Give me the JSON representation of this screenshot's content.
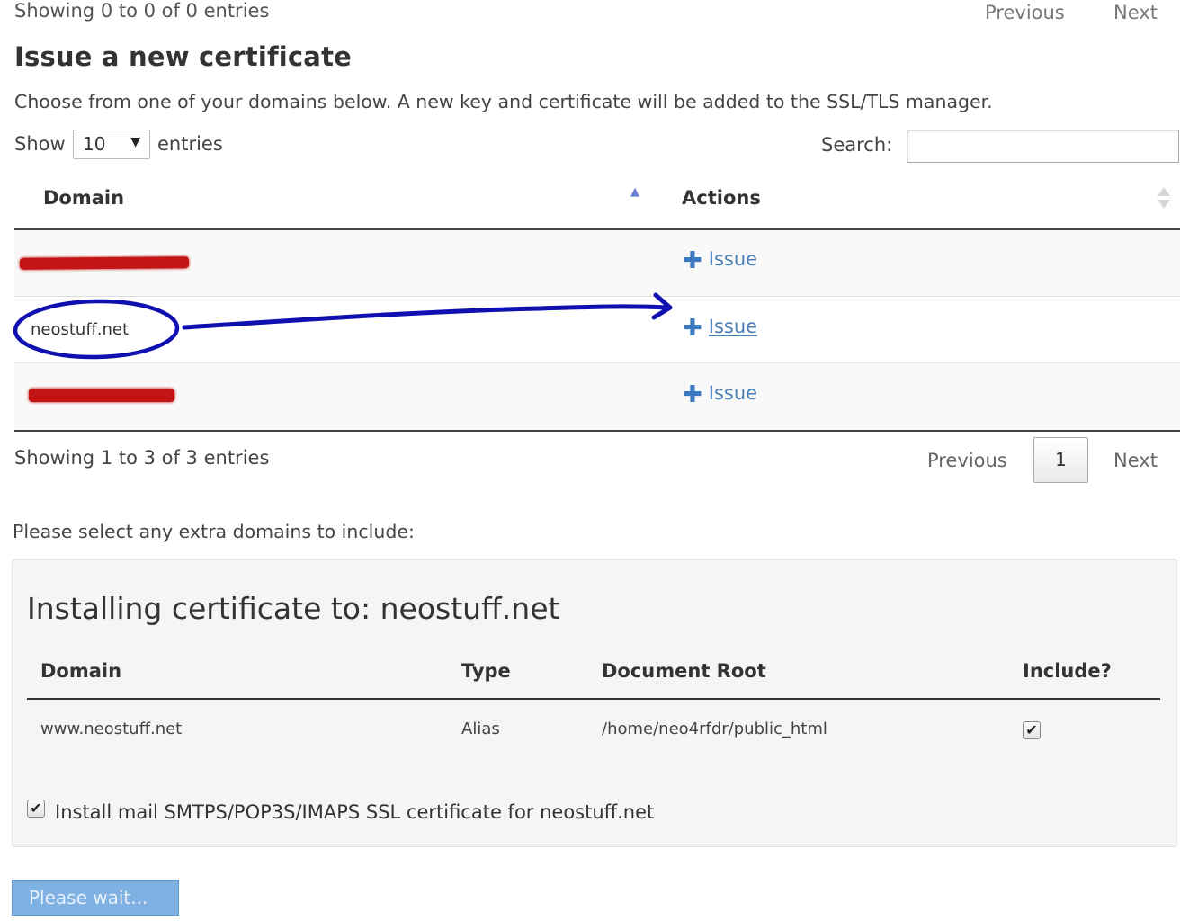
{
  "top_pagination": {
    "status": "Showing 0 to 0 of 0 entries",
    "previous": "Previous",
    "next": "Next"
  },
  "section": {
    "title": "Issue a new certificate",
    "description": "Choose from one of your domains below. A new key and certificate will be added to the SSL/TLS manager."
  },
  "length_control": {
    "show_label": "Show",
    "value": "10",
    "entries_label": "entries"
  },
  "search": {
    "label": "Search:",
    "value": ""
  },
  "table": {
    "headers": {
      "domain": "Domain",
      "actions": "Actions"
    },
    "rows": [
      {
        "domain": "[redacted]",
        "action": "Issue"
      },
      {
        "domain": "neostuff.net",
        "action": "Issue"
      },
      {
        "domain": "[redacted]",
        "action": "Issue"
      }
    ]
  },
  "bottom_pagination": {
    "status": "Showing 1 to 3 of 3 entries",
    "previous": "Previous",
    "page": "1",
    "next": "Next"
  },
  "extra_domains": {
    "label": "Please select any extra domains to include:",
    "install_title": "Installing certificate to: neostuff.net",
    "headers": {
      "domain": "Domain",
      "type": "Type",
      "document_root": "Document Root",
      "include": "Include?"
    },
    "rows": [
      {
        "domain": "www.neostuff.net",
        "type": "Alias",
        "document_root": "/home/neo4rfdr/public_html",
        "include": true
      }
    ],
    "mail_checkbox_label": "Install mail SMTPS/POP3S/IMAPS SSL certificate for neostuff.net",
    "mail_checked": true
  },
  "submit": {
    "label": "Please wait..."
  },
  "colors": {
    "link": "#4a7fb5",
    "redaction": "#c41515",
    "annotation": "#1010b0",
    "button_disabled": "#7fb1e2"
  },
  "icons": {
    "issue": "plus-icon",
    "checkbox": "checkmark-icon",
    "select": "dropdown-arrow-icon"
  }
}
